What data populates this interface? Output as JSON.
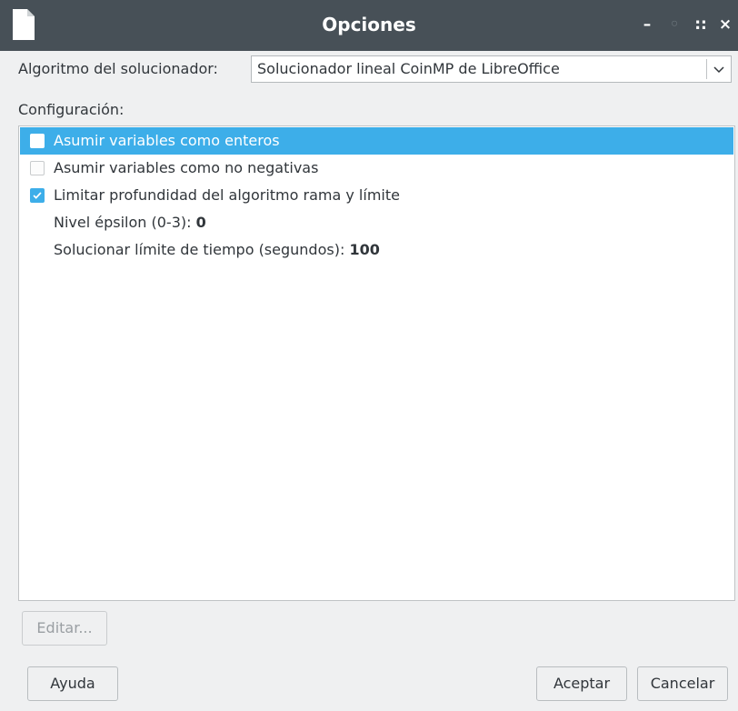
{
  "window": {
    "title": "Opciones",
    "controls": {
      "minimize": "–",
      "restore": "◦",
      "maximize": "::",
      "close": "×"
    }
  },
  "solver": {
    "label": "Algoritmo del solucionador:",
    "selected": "Solucionador lineal CoinMP de LibreOffice"
  },
  "config": {
    "label": "Configuración:",
    "items": [
      {
        "label": "Asumir variables como enteros",
        "checked": false,
        "selected": true
      },
      {
        "label": "Asumir variables como no negativas",
        "checked": false,
        "selected": false
      },
      {
        "label": "Limitar profundidad del algoritmo rama y límite",
        "checked": true,
        "selected": false
      },
      {
        "label": "Nivel épsilon (0-3):",
        "value": "0"
      },
      {
        "label": "Solucionar límite de tiempo (segundos):",
        "value": "100"
      }
    ]
  },
  "buttons": {
    "edit": "Editar...",
    "help": "Ayuda",
    "ok": "Aceptar",
    "cancel": "Cancelar"
  },
  "colors": {
    "titlebar": "#475057",
    "accent": "#3daee9",
    "background": "#eff0f1"
  }
}
